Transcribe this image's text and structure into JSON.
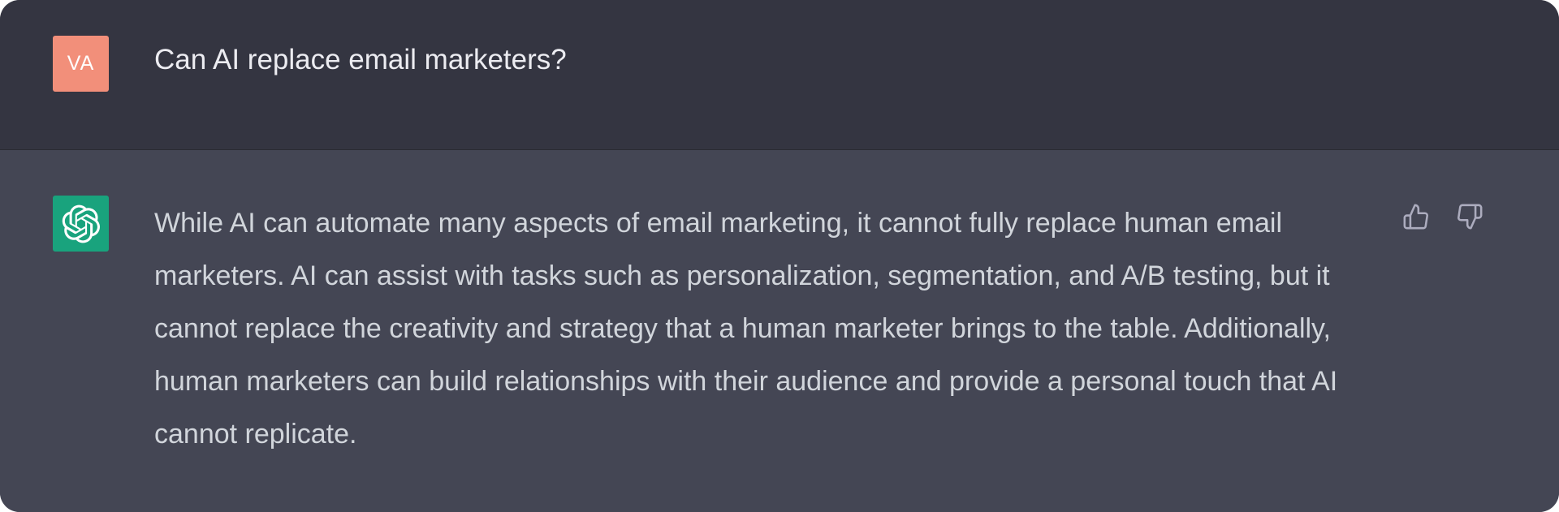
{
  "conversation": {
    "user_message": {
      "avatar_initials": "VA",
      "avatar_color": "#f28f7a",
      "text": "Can AI replace email marketers?"
    },
    "assistant_message": {
      "avatar_icon": "openai-logo-icon",
      "avatar_color": "#19a37d",
      "text": "While AI can automate many aspects of email marketing, it cannot fully replace human email marketers. AI can assist with tasks such as personalization, segmentation, and A/B testing, but it cannot replace the creativity and strategy that a human marketer brings to the table. Additionally, human marketers can build relationships with their audience and provide a personal touch that AI cannot replicate.",
      "feedback": {
        "thumbs_up_icon": "thumbs-up-icon",
        "thumbs_down_icon": "thumbs-down-icon"
      }
    }
  },
  "colors": {
    "user_row_bg": "#343541",
    "assistant_row_bg": "#444654",
    "text_primary": "#ececf1",
    "text_secondary": "#d1d5db",
    "icon_color": "#acacbe"
  }
}
